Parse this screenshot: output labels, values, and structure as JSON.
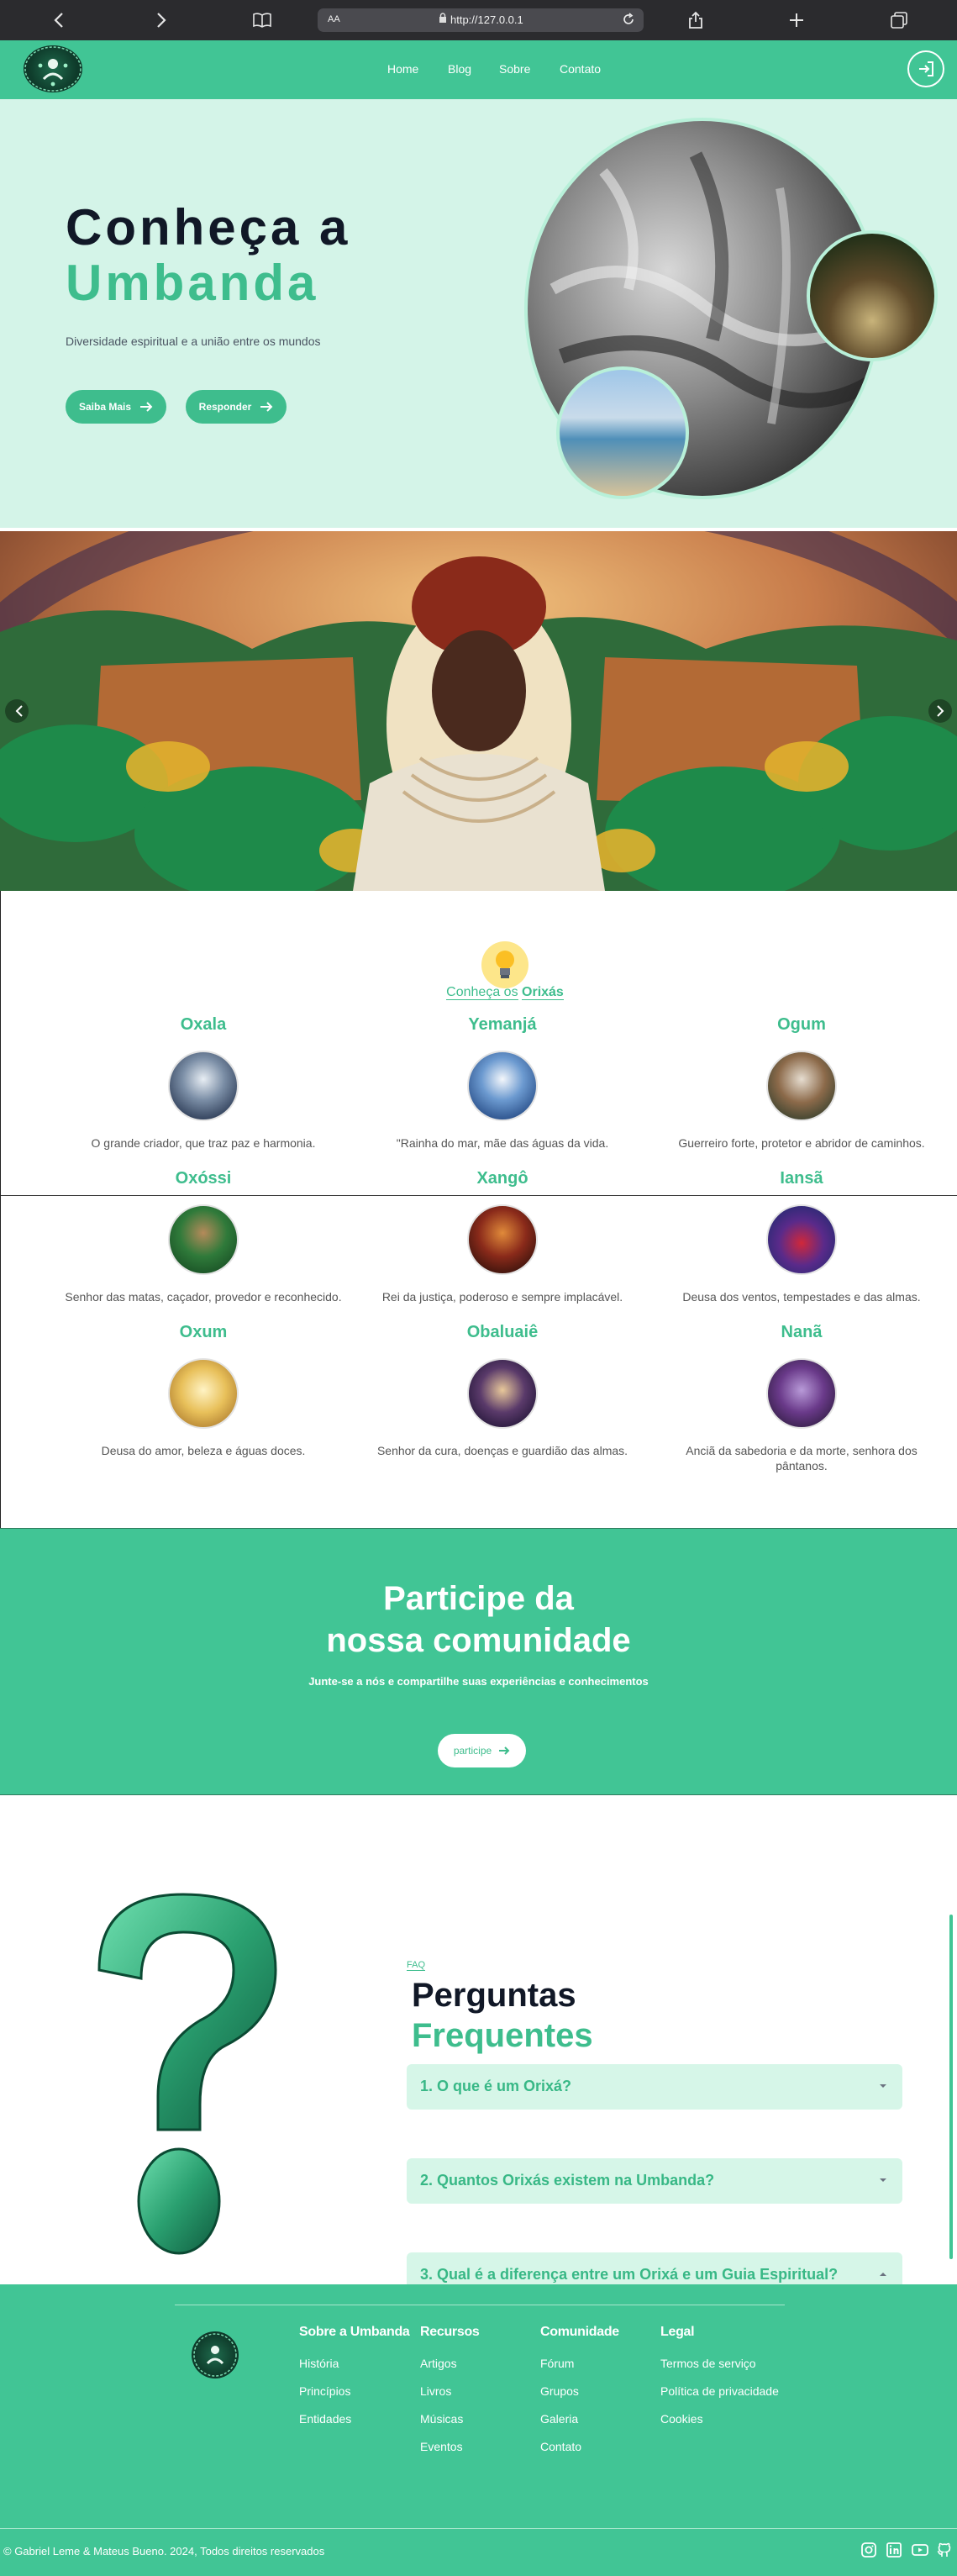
{
  "browser": {
    "url_prefix": "AA",
    "url": "http://127.0.0.1"
  },
  "navbar": {
    "links": [
      "Home",
      "Blog",
      "Sobre",
      "Contato"
    ]
  },
  "hero": {
    "title_line1": "Conheça a",
    "title_line2": "Umbanda",
    "subtitle": "Diversidade espiritual e a união entre os mundos",
    "btn_primary": "Saiba Mais",
    "btn_secondary": "Responder"
  },
  "orixas_section": {
    "heading_prefix": "Conheça os",
    "heading_highlight": "Orixás",
    "items": [
      {
        "name": "Oxala",
        "desc": "O grande criador, que traz paz e harmonia."
      },
      {
        "name": "Yemanjá",
        "desc": "\"Rainha do mar, mãe das águas da vida."
      },
      {
        "name": "Ogum",
        "desc": "Guerreiro forte, protetor e abridor de caminhos."
      },
      {
        "name": "Oxóssi",
        "desc": "Senhor das matas, caçador, provedor e reconhecido."
      },
      {
        "name": "Xangô",
        "desc": "Rei da justiça, poderoso e sempre implacável."
      },
      {
        "name": "Iansã",
        "desc": "Deusa dos ventos, tempestades e das almas."
      },
      {
        "name": "Oxum",
        "desc": "Deusa do amor, beleza e águas doces."
      },
      {
        "name": "Obaluaiê",
        "desc": "Senhor da cura, doenças e guardião das almas."
      },
      {
        "name": "Nanã",
        "desc": "Anciã da sabedoria e da morte, senhora dos pântanos."
      }
    ]
  },
  "community": {
    "title_line1": "Participe da",
    "title_line2": "nossa comunidade",
    "subtitle": "Junte-se a nós e compartilhe suas experiências e conhecimentos",
    "button": "participe"
  },
  "faq": {
    "tag": "FAQ",
    "title_line1": "Perguntas",
    "title_line2": "Frequentes",
    "items": [
      "1. O que é um Orixá?",
      "2. Quantos Orixás existem na Umbanda?",
      "3. Qual é a diferença entre um Orixá e um Guia Espiritual?"
    ]
  },
  "footer": {
    "columns": [
      {
        "title": "Sobre a Umbanda",
        "links": [
          "História",
          "Princípios",
          "Entidades"
        ]
      },
      {
        "title": "Recursos",
        "links": [
          "Artigos",
          "Livros",
          "Músicas",
          "Eventos"
        ]
      },
      {
        "title": "Comunidade",
        "links": [
          "Fórum",
          "Grupos",
          "Galeria",
          "Contato"
        ]
      },
      {
        "title": "Legal",
        "links": [
          "Termos de serviço",
          "Política de privacidade",
          "Cookies"
        ]
      }
    ],
    "copyright": "© Gabriel Leme & Mateus Bueno. 2024, Todos direitos reservados",
    "social_icons": [
      "instagram-icon",
      "linkedin-icon",
      "youtube-icon",
      "github-icon"
    ]
  },
  "colors": {
    "brand_green": "#41c595",
    "hero_bg": "#d4f4e8",
    "dark_text": "#111827"
  }
}
